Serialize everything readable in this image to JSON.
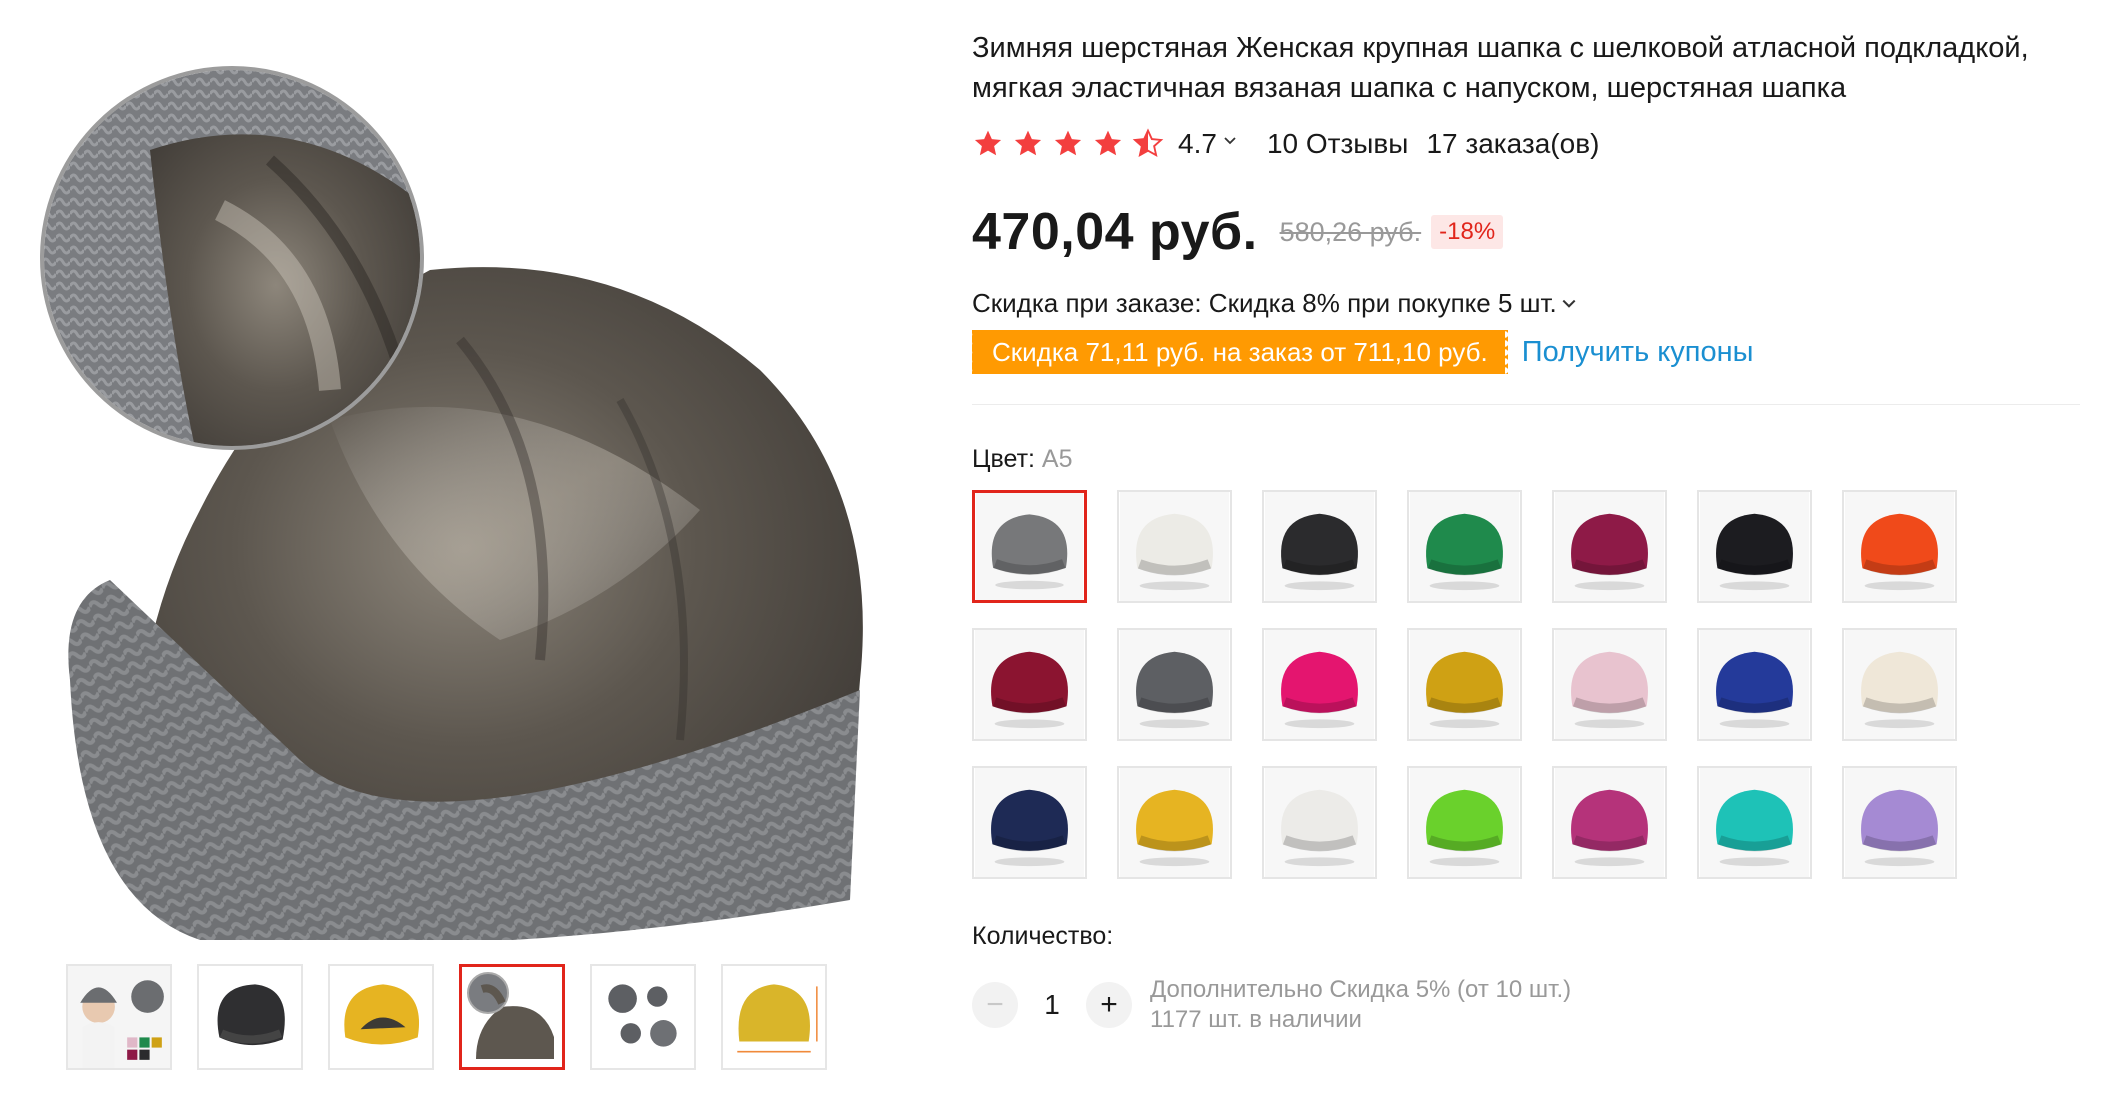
{
  "product": {
    "title": "Зимняя шерстяная Женская крупная шапка с шелковой атласной подкладкой, мягкая эластичная вязаная шапка с напуском, шерстяная шапка",
    "rating": "4.7",
    "rating_stars": 4.5,
    "reviews": "10 Отзывы",
    "orders": "17 заказа(ов)",
    "price": "470,04 руб.",
    "old_price": "580,26 руб.",
    "discount": "-18%",
    "bulk_discount": "Скидка при заказе: Скидка 8% при покупке 5 шт.",
    "coupon_text": "Скидка 71,11 руб. на заказ от 711,10 руб.",
    "get_coupons": "Получить купоны"
  },
  "color": {
    "label": "Цвет: ",
    "selected": "A5",
    "swatches": [
      {
        "name": "gray",
        "color": "#77787a"
      },
      {
        "name": "white",
        "color": "#ecebe6"
      },
      {
        "name": "black",
        "color": "#2b2b2d"
      },
      {
        "name": "green",
        "color": "#1f8a4c"
      },
      {
        "name": "wine",
        "color": "#8e1a47"
      },
      {
        "name": "black-r",
        "color": "#1c1c20"
      },
      {
        "name": "orange-r",
        "color": "#f04a1a"
      },
      {
        "name": "burgundy-r",
        "color": "#8b1430"
      },
      {
        "name": "gray-r",
        "color": "#5d5f63"
      },
      {
        "name": "pink-r",
        "color": "#e4156f"
      },
      {
        "name": "mustard",
        "color": "#cfa114"
      },
      {
        "name": "light-pink",
        "color": "#e8c3cf"
      },
      {
        "name": "blue-model",
        "color": "#243a9a"
      },
      {
        "name": "cream",
        "color": "#efe7d8"
      },
      {
        "name": "navy",
        "color": "#1e2a55"
      },
      {
        "name": "yellow-r",
        "color": "#e6b422"
      },
      {
        "name": "white-r",
        "color": "#ecebe8"
      },
      {
        "name": "lime-r",
        "color": "#6ad12c"
      },
      {
        "name": "magenta-model",
        "color": "#b5337a"
      },
      {
        "name": "teal-r",
        "color": "#1ec2b7"
      },
      {
        "name": "lavender-r",
        "color": "#a58ad3"
      }
    ]
  },
  "quantity": {
    "label": "Количество:",
    "value": "1",
    "extra_discount": "Дополнительно Скидка 5% (от 10 шт.)",
    "stock": "1177 шт. в наличии"
  },
  "gallery": {
    "thumbnails": [
      {
        "name": "model-colors"
      },
      {
        "name": "black-hat"
      },
      {
        "name": "yellow-hat"
      },
      {
        "name": "lining-gray",
        "selected": true
      },
      {
        "name": "gray-set"
      },
      {
        "name": "size-chart"
      }
    ]
  },
  "colors": {
    "star": "#f33f3f",
    "price": "#191919",
    "accent_red": "#e1251b",
    "coupon_bg": "#ff9a02",
    "link_blue": "#1a8fd1"
  }
}
